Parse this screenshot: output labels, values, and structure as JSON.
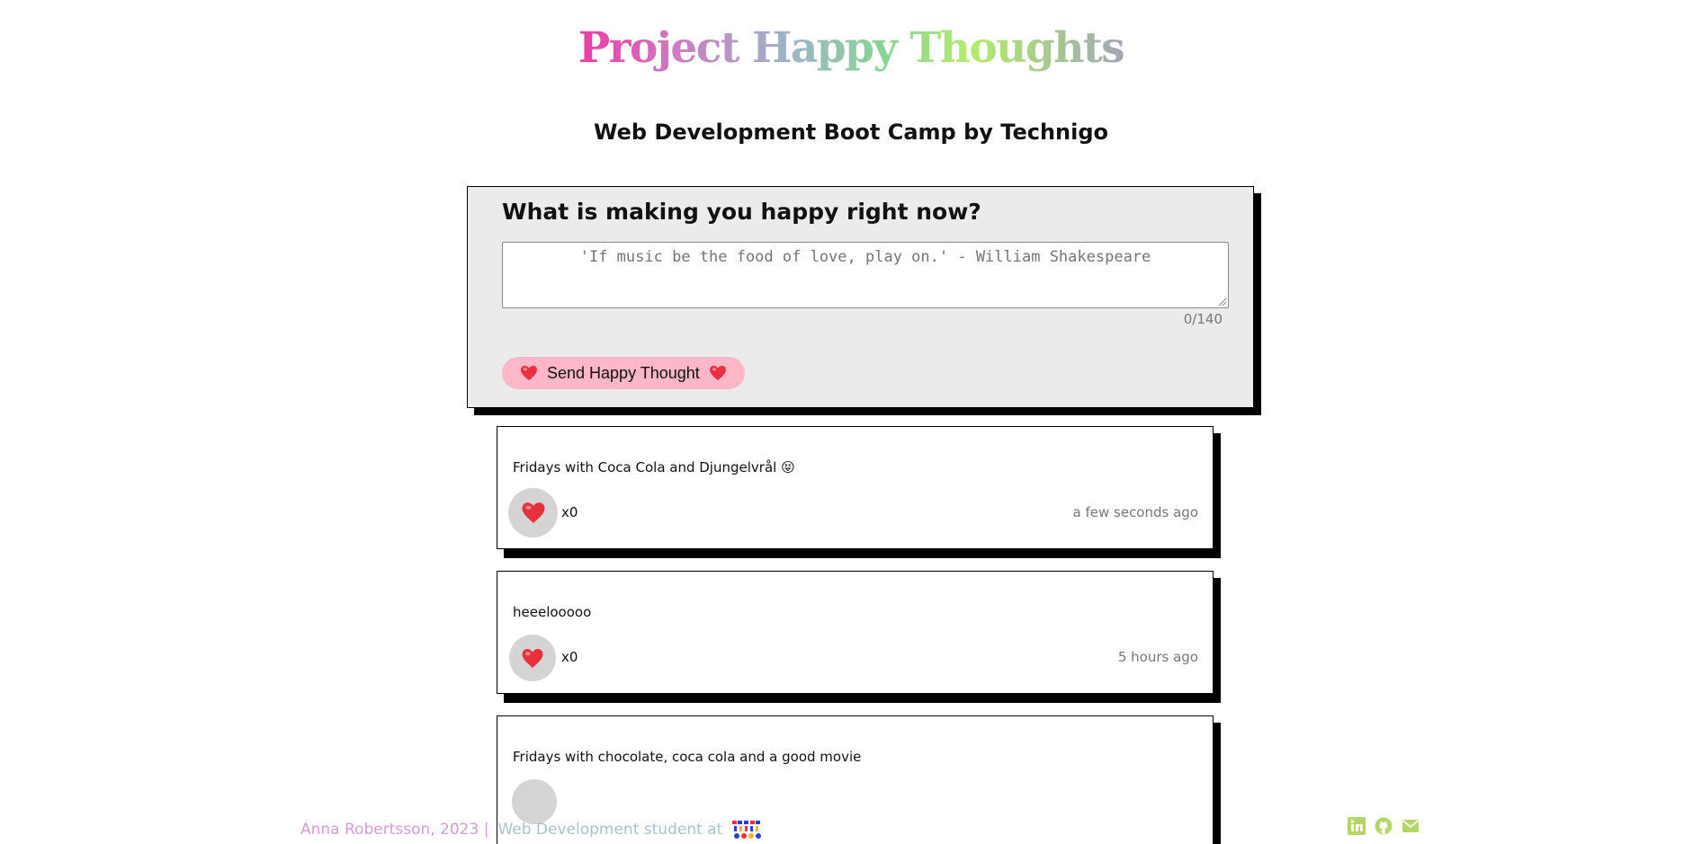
{
  "header": {
    "title": "Project Happy Thoughts",
    "subtitle": "Web Development Boot Camp by Technigo"
  },
  "form": {
    "question": "What is making you happy right now?",
    "input_placeholder": "'If music be the food of love, play on.' - William Shakespeare",
    "input_value": "",
    "char_count": "0/140",
    "send_label": "Send Happy Thought"
  },
  "thoughts": [
    {
      "message": "Fridays with Coca Cola and Djungelvrål 😝",
      "likes": "x0",
      "time": "a few seconds ago"
    },
    {
      "message": "heeelooooo",
      "likes": "x0",
      "time": "5 hours ago"
    },
    {
      "message": "Fridays with chocolate, coca cola and a good movie",
      "likes": "",
      "time": ""
    }
  ],
  "footer": {
    "name": "Anna Robertsson, 2023 |",
    "role": "Web Development student at",
    "logo_text": "TECHNIGO",
    "links": [
      "linkedin-icon",
      "github-icon",
      "email-icon"
    ]
  },
  "colors": {
    "accent_pink": "#ffb6c8",
    "form_bg": "#ebebeb",
    "like_bg": "#d4d4d4",
    "footer_icon": "#b5d56a"
  }
}
